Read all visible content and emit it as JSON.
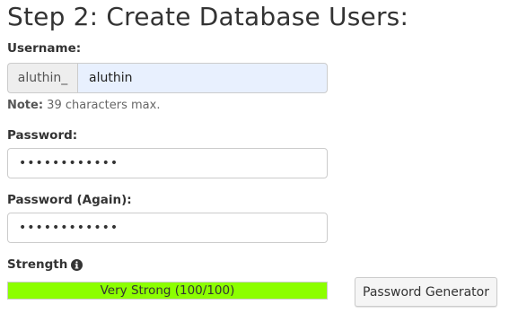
{
  "heading": "Step 2: Create Database Users:",
  "username": {
    "label": "Username:",
    "prefix": "aluthin_",
    "value": "aluthin",
    "note_label": "Note:",
    "note_text": " 39 characters max."
  },
  "password": {
    "label": "Password:",
    "value": "••••••••••••"
  },
  "password_again": {
    "label": "Password (Again):",
    "value": "••••••••••••"
  },
  "strength": {
    "label": "Strength",
    "icon": "info-circle-icon",
    "text": "Very Strong (100/100)",
    "score_percent": 100,
    "color": "#8cff00"
  },
  "generator_button": {
    "label": "Password Generator"
  }
}
